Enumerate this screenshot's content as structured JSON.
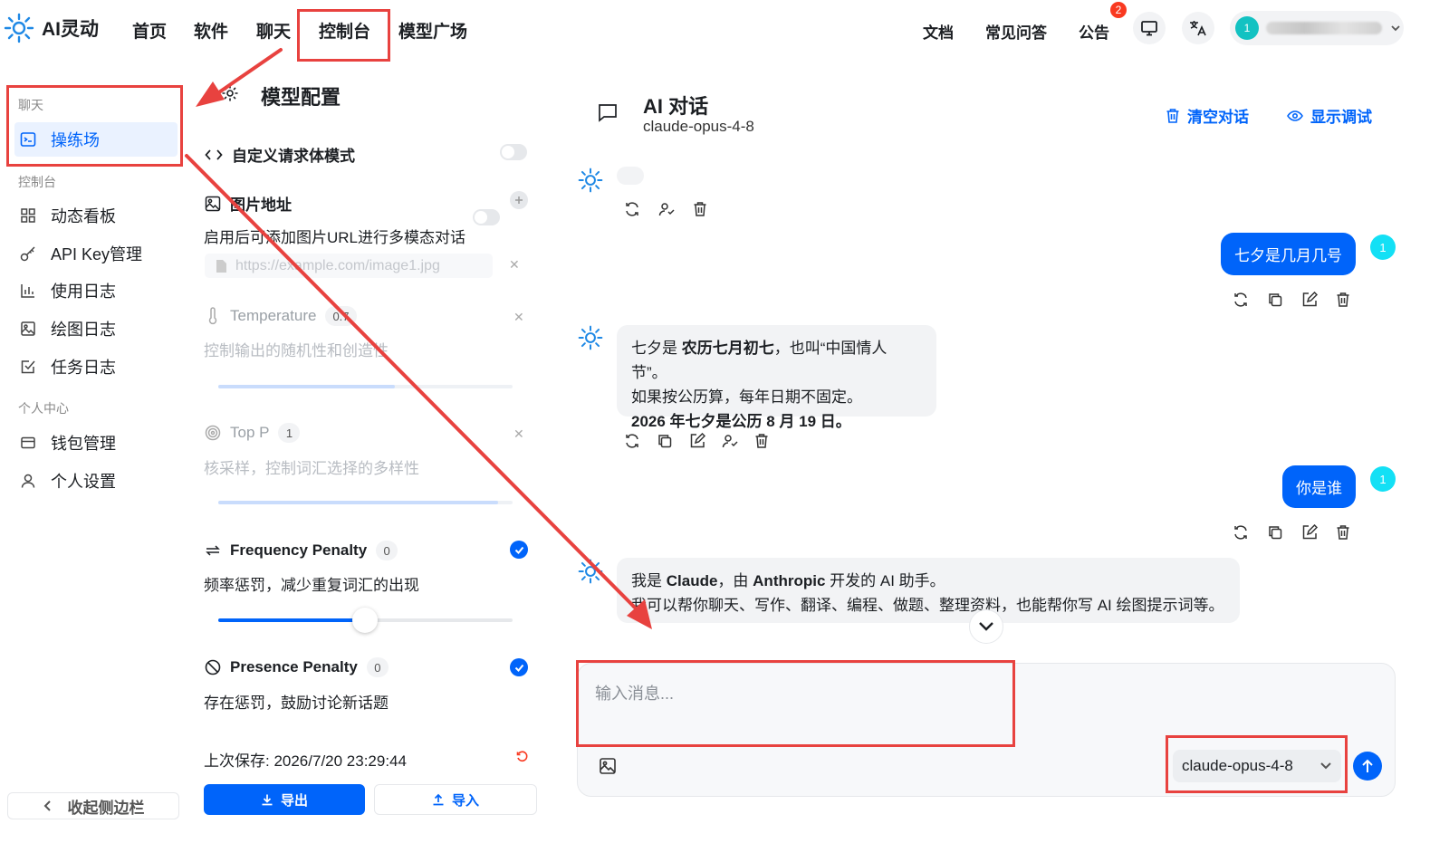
{
  "brand": {
    "name": "AI灵动"
  },
  "nav": {
    "home": "首页",
    "software": "软件",
    "chat": "聊天",
    "console": "控制台",
    "model_square": "模型广场"
  },
  "top_right": {
    "docs": "文档",
    "faq": "常见问答",
    "notice": "公告",
    "notice_badge": "2",
    "user_avatar": "1"
  },
  "sidebar": {
    "section_chat": "聊天",
    "playground": "操练场",
    "section_console": "控制台",
    "dashboard": "动态看板",
    "api_key": "API Key管理",
    "usage_log": "使用日志",
    "draw_log": "绘图日志",
    "task_log": "任务日志",
    "section_personal": "个人中心",
    "wallet": "钱包管理",
    "settings": "个人设置",
    "collapse": "收起侧边栏"
  },
  "config": {
    "title": "模型配置",
    "custom_body": "自定义请求体模式",
    "image_url": "图片地址",
    "image_url_desc": "启用后可添加图片URL进行多模态对话",
    "image_url_placeholder": "https://example.com/image1.jpg",
    "temperature": "Temperature",
    "temperature_value": "0.7",
    "temperature_desc": "控制输出的随机性和创造性",
    "top_p": "Top P",
    "top_p_value": "1",
    "top_p_desc": "核采样，控制词汇选择的多样性",
    "freq_penalty": "Frequency Penalty",
    "freq_penalty_value": "0",
    "freq_penalty_desc": "频率惩罚，减少重复词汇的出现",
    "presence_penalty": "Presence Penalty",
    "presence_penalty_value": "0",
    "presence_penalty_desc": "存在惩罚，鼓励讨论新话题",
    "last_saved": "上次保存: 2026/7/20 23:29:44",
    "export": "导出",
    "import": "导入",
    "temperature_level": 0.6,
    "top_p_level": 0.95,
    "freq_penalty_level": 0.5
  },
  "chat": {
    "title": "AI 对话",
    "model": "claude-opus-4-8",
    "clear": "清空对话",
    "debug": "显示调试",
    "user_msg_1": "七夕是几月几号",
    "ai_msg_1_a": "七夕是 ",
    "ai_msg_1_b": "农历七月初七",
    "ai_msg_1_c": "，也叫“中国情人节”。",
    "ai_msg_1_line2": "如果按公历算，每年日期不固定。",
    "ai_msg_1_line3": "2026 年七夕是公历 8 月 19 日。",
    "user_msg_2": "你是谁",
    "ai_msg_2_a": "我是 ",
    "ai_msg_2_b": "Claude",
    "ai_msg_2_c": "，由 ",
    "ai_msg_2_d": "Anthropic",
    "ai_msg_2_e": " 开发的 AI 助手。",
    "ai_msg_2_line2": "我可以帮你聊天、写作、翻译、编程、做题、整理资料，也能帮你写 AI 绘图提示词等。",
    "user_avatar": "1",
    "input_placeholder": "输入消息...",
    "model_select": "claude-opus-4-8"
  },
  "colors": {
    "accent": "#0064fa",
    "highlight": "#e8423f",
    "ai_bubble": "#f2f3f5"
  }
}
